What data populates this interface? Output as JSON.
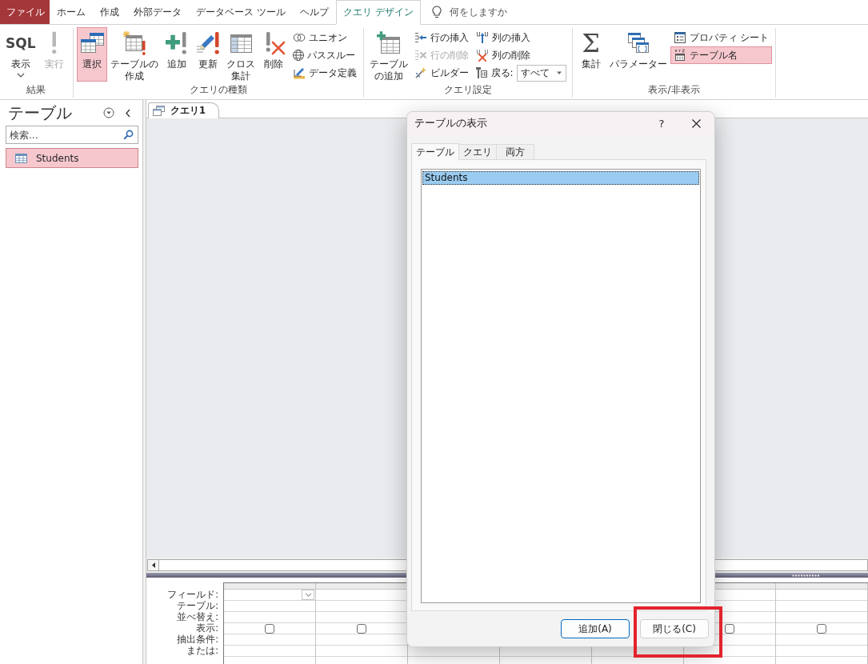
{
  "ribbon_tabs": [
    {
      "label": "ファイル",
      "kind": "file",
      "selected": false
    },
    {
      "label": "ホーム",
      "kind": "tab",
      "selected": false
    },
    {
      "label": "作成",
      "kind": "tab",
      "selected": false
    },
    {
      "label": "外部データ",
      "kind": "tab",
      "selected": false
    },
    {
      "label": "データベース ツール",
      "kind": "tab",
      "selected": false
    },
    {
      "label": "ヘルプ",
      "kind": "tab",
      "selected": false
    },
    {
      "label": "クエリ デザイン",
      "kind": "tab",
      "selected": true
    }
  ],
  "tell_me": {
    "placeholder": "何をしますか"
  },
  "ribbon": {
    "groups": [
      {
        "label": "結果",
        "controls": [
          {
            "kind": "large",
            "label": "表示",
            "icon_text": "SQL",
            "dropdown": true,
            "selected": false,
            "disabled": false
          },
          {
            "kind": "large",
            "label": "実行",
            "selected": false,
            "disabled": true
          }
        ]
      },
      {
        "label": "クエリの種類",
        "controls": [
          {
            "kind": "large",
            "label": "選択",
            "selected": true,
            "disabled": false
          },
          {
            "kind": "large",
            "label": [
              "テーブルの",
              "作成"
            ],
            "selected": false,
            "disabled": false
          },
          {
            "kind": "large",
            "label": "追加",
            "selected": false,
            "disabled": false
          },
          {
            "kind": "large",
            "label": "更新",
            "selected": false,
            "disabled": false
          },
          {
            "kind": "large",
            "label": [
              "クロス",
              "集計"
            ],
            "selected": false,
            "disabled": false
          },
          {
            "kind": "large",
            "label": "削除",
            "selected": false,
            "disabled": false
          },
          {
            "kind": "small",
            "label": "ユニオン",
            "selected": false,
            "disabled": false
          },
          {
            "kind": "small",
            "label": "パススルー",
            "selected": false,
            "disabled": false
          },
          {
            "kind": "small",
            "label": "データ定義",
            "selected": false,
            "disabled": false
          }
        ]
      },
      {
        "label": "クエリ設定",
        "controls": [
          {
            "kind": "large",
            "label": [
              "テーブル",
              "の追加"
            ],
            "selected": false,
            "disabled": false
          },
          {
            "kind": "small",
            "label": "行の挿入",
            "selected": false,
            "disabled": false
          },
          {
            "kind": "small",
            "label": "行の削除",
            "selected": false,
            "disabled": true
          },
          {
            "kind": "small",
            "label": "ビルダー",
            "selected": false,
            "disabled": false
          },
          {
            "kind": "small",
            "label": "列の挿入",
            "selected": false,
            "disabled": false
          },
          {
            "kind": "small",
            "label": "列の削除",
            "selected": false,
            "disabled": false
          },
          {
            "kind": "combo",
            "label": "戻る:",
            "value": "すべて",
            "selected": false,
            "disabled": false
          }
        ]
      },
      {
        "label": "表示/非表示",
        "controls": [
          {
            "kind": "large",
            "label": "集計",
            "icon_text": "Σ",
            "selected": false,
            "disabled": false
          },
          {
            "kind": "large",
            "label": "パラメーター",
            "selected": false,
            "disabled": false
          },
          {
            "kind": "small",
            "label": "プロパティ シート",
            "selected": false,
            "disabled": false
          },
          {
            "kind": "small",
            "label": "テーブル名",
            "selected": true,
            "disabled": false
          }
        ]
      }
    ]
  },
  "navigation_pane": {
    "title": "テーブル",
    "search": {
      "placeholder": "検索..."
    },
    "items": [
      {
        "label": "Students",
        "selected": true
      }
    ]
  },
  "document_tabs": [
    {
      "label": "クエリ1",
      "selected": true
    }
  ],
  "design_grid": {
    "rows": [
      {
        "label": "フィールド:",
        "kind": "field"
      },
      {
        "label": "テーブル:",
        "kind": "text"
      },
      {
        "label": "並べ替え:",
        "kind": "text"
      },
      {
        "label": "表示:",
        "kind": "check"
      },
      {
        "label": "抽出条件:",
        "kind": "text"
      },
      {
        "label": "または:",
        "kind": "text"
      }
    ],
    "columns": [
      {
        "active": true,
        "show": false
      },
      {
        "active": false,
        "show": false
      },
      {},
      {},
      {},
      {
        "active": false,
        "show": false
      },
      {
        "active": false,
        "show": false
      }
    ]
  },
  "dialog": {
    "title": "テーブルの表示",
    "help": "?",
    "tabs": [
      {
        "label": "テーブル",
        "selected": true
      },
      {
        "label": "クエリ",
        "selected": false
      },
      {
        "label": "両方",
        "selected": false
      }
    ],
    "items": [
      {
        "label": "Students",
        "selected": true
      }
    ],
    "buttons": [
      {
        "label": "追加(A)",
        "default": true,
        "highlighted": false
      },
      {
        "label": "閉じる(C)",
        "default": false,
        "highlighted": true
      }
    ]
  }
}
